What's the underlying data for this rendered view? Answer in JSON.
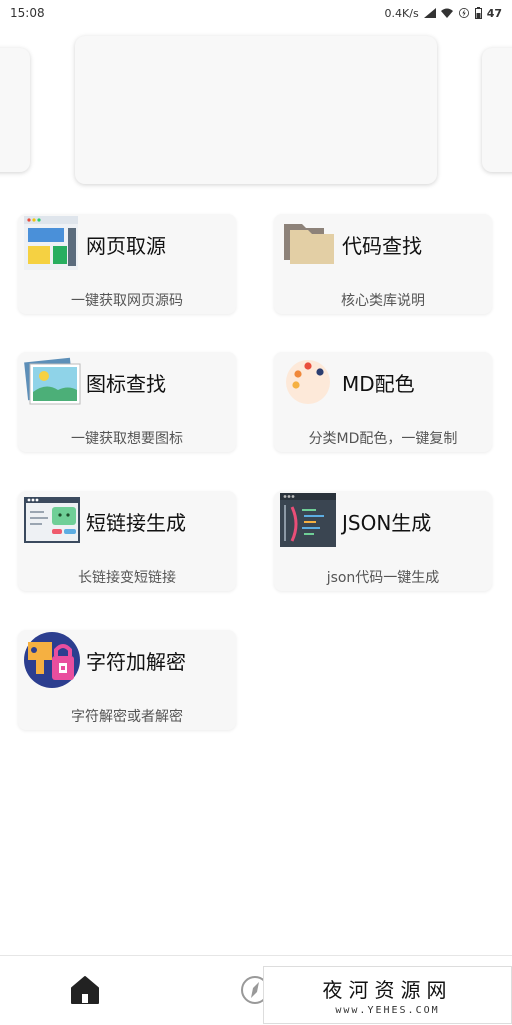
{
  "status_bar": {
    "time": "15:08",
    "net_speed": "0.4K/s",
    "battery": "47"
  },
  "cards": [
    {
      "title": "网页取源",
      "subtitle": "一键获取网页源码",
      "icon": "webpage-icon"
    },
    {
      "title": "代码查找",
      "subtitle": "核心类库说明",
      "icon": "folder-icon"
    },
    {
      "title": "图标查找",
      "subtitle": "一键获取想要图标",
      "icon": "image-icon"
    },
    {
      "title": "MD配色",
      "subtitle": "分类MD配色，一键复制",
      "icon": "palette-icon"
    },
    {
      "title": "短链接生成",
      "subtitle": "长链接变短链接",
      "icon": "short-link-icon"
    },
    {
      "title": "JSON生成",
      "subtitle": "json代码一键生成",
      "icon": "code-icon"
    },
    {
      "title": "字符加解密",
      "subtitle": "字符解密或者解密",
      "icon": "lock-key-icon"
    }
  ],
  "bottom_nav": [
    {
      "icon": "home-icon",
      "active": true
    },
    {
      "icon": "compass-icon",
      "active": false
    },
    {
      "icon": "settings-icon",
      "active": false
    }
  ],
  "watermark": {
    "title": "夜河资源网",
    "url": "www.YEHES.COM"
  },
  "colors": {
    "card_bg": "#f7f7f7",
    "text_primary": "#111111",
    "text_secondary": "#555555"
  }
}
